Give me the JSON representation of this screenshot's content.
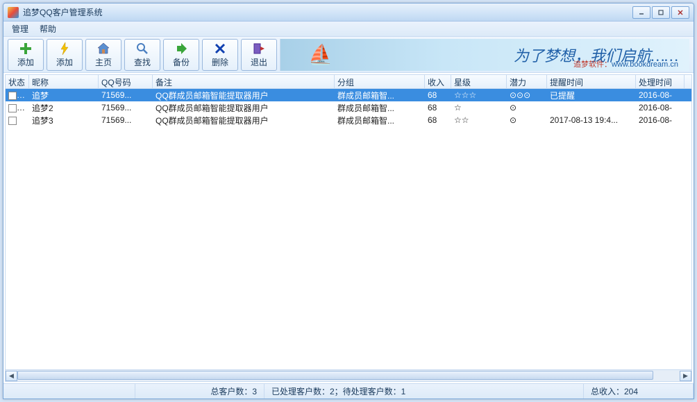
{
  "window": {
    "title": "追梦QQ客户管理系统"
  },
  "menu": {
    "manage": "管理",
    "help": "帮助"
  },
  "toolbar": [
    {
      "key": "add1",
      "label": "添加"
    },
    {
      "key": "add2",
      "label": "添加"
    },
    {
      "key": "home",
      "label": "主页"
    },
    {
      "key": "search",
      "label": "查找"
    },
    {
      "key": "backup",
      "label": "备份"
    },
    {
      "key": "delete",
      "label": "删除"
    },
    {
      "key": "exit",
      "label": "退出"
    }
  ],
  "banner": {
    "slogan": "为了梦想，我们启航……",
    "company": "追梦软件：",
    "url": "www.bookdream.cn"
  },
  "columns": {
    "status": "状态",
    "nick": "昵称",
    "qq": "QQ号码",
    "note": "备注",
    "group": "分组",
    "income": "收入",
    "star": "星级",
    "potential": "潜力",
    "remind": "提醒时间",
    "process": "处理时间"
  },
  "rows": [
    {
      "checked": false,
      "status": "✓",
      "nick": "追梦",
      "qq": "71569...",
      "note": "QQ群成员邮箱智能提取器用户",
      "group": "群成员邮箱智...",
      "income": "68",
      "star": "☆☆☆",
      "potential": "⊙⊙⊙",
      "remind": "已提醒",
      "process": "2016-08-",
      "selected": true
    },
    {
      "checked": false,
      "status": "✓",
      "nick": "追梦2",
      "qq": "71569...",
      "note": "QQ群成员邮箱智能提取器用户",
      "group": "群成员邮箱智...",
      "income": "68",
      "star": "☆",
      "potential": "⊙",
      "remind": "",
      "process": "2016-08-",
      "selected": false
    },
    {
      "checked": false,
      "status": "",
      "nick": "追梦3",
      "qq": "71569...",
      "note": "QQ群成员邮箱智能提取器用户",
      "group": "群成员邮箱智...",
      "income": "68",
      "star": "☆☆",
      "potential": "⊙",
      "remind": "2017-08-13 19:4...",
      "process": "2016-08-",
      "selected": false
    }
  ],
  "statusbar": {
    "total": "总客户数：3",
    "processed": "已处理客户数：2；待处理客户数：1",
    "income": "总收入：204"
  }
}
